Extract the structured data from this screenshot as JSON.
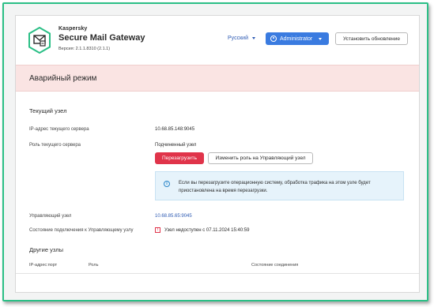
{
  "header": {
    "company": "Kaspersky",
    "product": "Secure Mail Gateway",
    "version": "Версия: 2.1.1.8310 (2.1.1)",
    "language": "Русский",
    "user": "Administrator",
    "update_button": "Установить обновление"
  },
  "emergency": {
    "title": "Аварийный режим"
  },
  "current_node": {
    "title": "Текущий узел",
    "ip_label": "IP-адрес текущего сервера",
    "ip_value": "10.68.85.148:9045",
    "role_label": "Роль текущего сервера",
    "role_value": "Подчиненный узел",
    "restart_button": "Перезагрузить",
    "change_role_button": "Изменить роль на Управляющий узел",
    "info_text": "Если вы перезагрузите операционную систему, обработка трафика на этом узле будет приостановлена на время перезагрузки.",
    "control_node_label": "Управляющий узел",
    "control_node_value": "10.68.85.65:9045",
    "connection_label": "Состояние подключения к Управляющему узлу",
    "connection_value": "Узел недоступен с 07.11.2024 15:40:59"
  },
  "other_nodes": {
    "title": "Другие узлы",
    "columns": [
      "IP-адрес:порт",
      "Роль",
      "Состояние соединения"
    ]
  },
  "colors": {
    "accent": "#2bbf86",
    "primary": "#3a7be0",
    "danger": "#e0344a",
    "emergency_bg": "#fae4e3",
    "info_bg": "#e6f3fb"
  },
  "icons": [
    "kaspersky-mail-shield-icon",
    "user-icon",
    "chevron-down-icon",
    "info-icon",
    "warning-icon"
  ]
}
